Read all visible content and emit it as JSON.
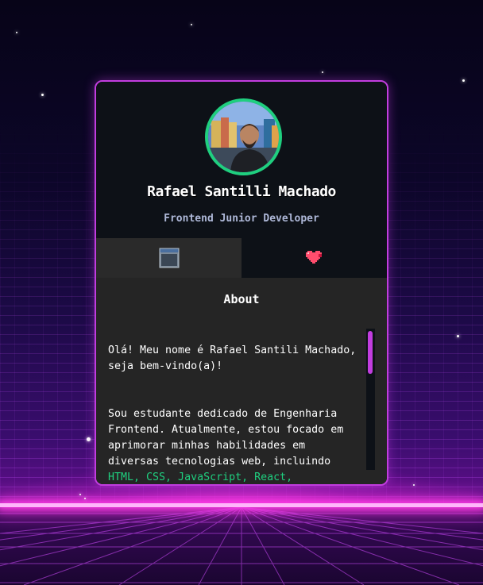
{
  "profile": {
    "name": "Rafael Santilli Machado",
    "role": "Frontend Junior Developer",
    "avatar": "profile-photo"
  },
  "tabs": [
    {
      "icon": "window-icon",
      "active": true
    },
    {
      "icon": "heart-icon",
      "active": false
    }
  ],
  "about": {
    "title": "About",
    "greeting": "Olá! Meu nome é Rafael Santili Machado, seja bem-vindo(a)!",
    "body_intro": "Sou estudante dedicado de Engenharia Frontend. Atualmente, estou focado em aprimorar minhas habilidades em diversas tecnologias web, incluindo",
    "highlight": "HTML, CSS, JavaScript, React, TypeScript e Redux.",
    "scroll_position": 0.0
  },
  "colors": {
    "card_border": "#c23ddf",
    "accent_green": "#1fcf7f",
    "panel_bg": "#252525",
    "card_bg": "#0d1117"
  }
}
